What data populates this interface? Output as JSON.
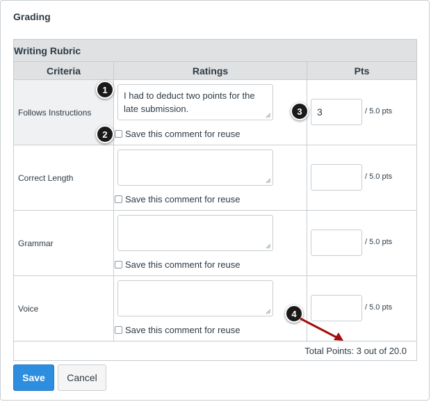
{
  "page": {
    "title": "Grading"
  },
  "rubric": {
    "title": "Writing Rubric",
    "headers": {
      "criteria": "Criteria",
      "ratings": "Ratings",
      "pts": "Pts"
    },
    "rows": [
      {
        "criterion": "Follows Instructions",
        "comment": "I had to deduct two points for the late submission.",
        "comment_placeholder": "",
        "reuse_label": "Save this comment for reuse",
        "reuse_checked": false,
        "points": "3",
        "points_suffix": "/ 5.0 pts"
      },
      {
        "criterion": "Correct Length",
        "comment": "",
        "comment_placeholder": "",
        "reuse_label": "Save this comment for reuse",
        "reuse_checked": false,
        "points": "",
        "points_suffix": "/ 5.0 pts"
      },
      {
        "criterion": "Grammar",
        "comment": "",
        "comment_placeholder": "",
        "reuse_label": "Save this comment for reuse",
        "reuse_checked": false,
        "points": "",
        "points_suffix": "/ 5.0 pts"
      },
      {
        "criterion": "Voice",
        "comment": "",
        "comment_placeholder": "",
        "reuse_label": "Save this comment for reuse",
        "reuse_checked": false,
        "points": "",
        "points_suffix": "/ 5.0 pts"
      }
    ],
    "total": "Total Points: 3 out of 20.0"
  },
  "buttons": {
    "save": "Save",
    "cancel": "Cancel"
  },
  "callouts": [
    "1",
    "2",
    "3",
    "4"
  ],
  "colors": {
    "header_bg": "#dfe1e3",
    "save_button": "#2d8ee0",
    "callout": "#1a1a1a",
    "arrow": "#a30d0d"
  }
}
